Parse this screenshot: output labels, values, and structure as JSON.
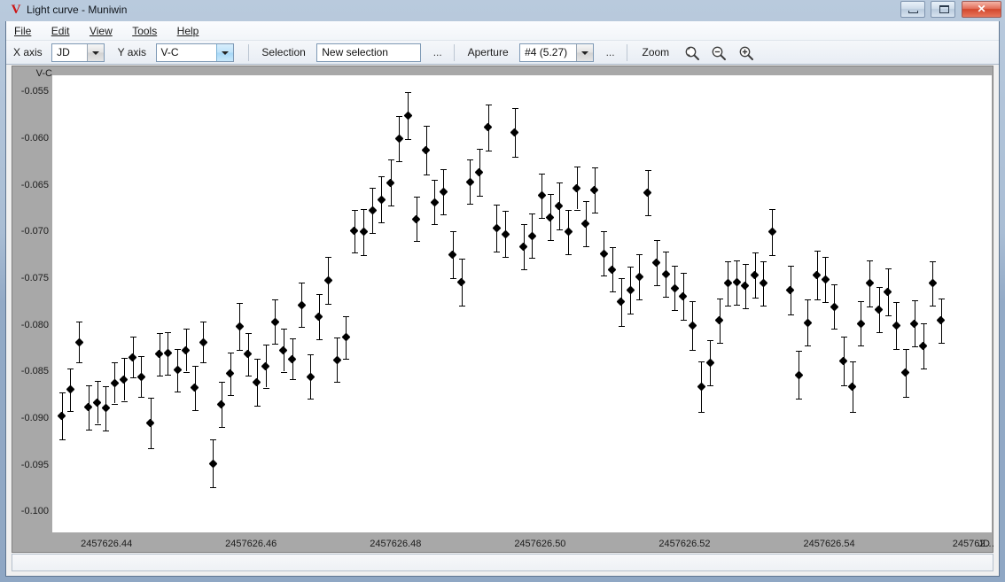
{
  "window": {
    "title": "Light curve - Muniwin",
    "app_icon": "muniwin-v-icon",
    "buttons": {
      "minimize": "minimize",
      "maximize": "maximize",
      "close": "✕"
    }
  },
  "menu": {
    "items": [
      "File",
      "Edit",
      "View",
      "Tools",
      "Help"
    ]
  },
  "toolbar": {
    "x_axis_label": "X axis",
    "x_axis_value": "JD",
    "y_axis_label": "Y axis",
    "y_axis_value": "V-C",
    "selection_label": "Selection",
    "selection_value": "New selection",
    "selection_more": "...",
    "aperture_label": "Aperture",
    "aperture_value": "#4 (5.27)",
    "aperture_more": "...",
    "zoom_label": "Zoom",
    "zoom_fit_icon": "zoom-fit-icon",
    "zoom_out_icon": "zoom-out-icon",
    "zoom_in_icon": "zoom-in-icon"
  },
  "chart_data": {
    "type": "scatter",
    "title": "",
    "xlabel": "JD",
    "ylabel": "V-C",
    "grid": false,
    "legend": null,
    "errorbars": true,
    "marker": "filled-diamond",
    "marker_color": "#000000",
    "xlim": [
      2457626.4325,
      2457626.5625
    ],
    "ylim": [
      -0.1022,
      -0.0532
    ],
    "y_inverted": false,
    "xticks": [
      2457626.44,
      2457626.46,
      2457626.48,
      2457626.5,
      2457626.52,
      2457626.54,
      2457626.56
    ],
    "xtick_labels": [
      "2457626.44",
      "2457626.46",
      "2457626.48",
      "2457626.50",
      "2457626.52",
      "2457626.54",
      "245762…"
    ],
    "yticks": [
      -0.1,
      -0.095,
      -0.09,
      -0.085,
      -0.08,
      -0.075,
      -0.07,
      -0.065,
      -0.06,
      -0.055
    ],
    "ytick_labels": [
      "-0.100",
      "-0.095",
      "-0.090",
      "-0.085",
      "-0.080",
      "-0.075",
      "-0.070",
      "-0.065",
      "-0.060",
      "-0.055"
    ],
    "series_name": "V-C",
    "x": [
      2457626.4338,
      2457626.435,
      2457626.4362,
      2457626.4375,
      2457626.4387,
      2457626.4399,
      2457626.4411,
      2457626.4424,
      2457626.4436,
      2457626.4448,
      2457626.4461,
      2457626.4473,
      2457626.4485,
      2457626.4498,
      2457626.451,
      2457626.4522,
      2457626.4534,
      2457626.4547,
      2457626.4559,
      2457626.4571,
      2457626.4584,
      2457626.4596,
      2457626.4608,
      2457626.462,
      2457626.4633,
      2457626.4645,
      2457626.4657,
      2457626.467,
      2457626.4682,
      2457626.4694,
      2457626.4707,
      2457626.4719,
      2457626.4731,
      2457626.4743,
      2457626.4756,
      2457626.4768,
      2457626.478,
      2457626.4793,
      2457626.4805,
      2457626.4817,
      2457626.4829,
      2457626.4842,
      2457626.4854,
      2457626.4866,
      2457626.4879,
      2457626.4891,
      2457626.4903,
      2457626.4916,
      2457626.4928,
      2457626.494,
      2457626.4952,
      2457626.4965,
      2457626.4977,
      2457626.4989,
      2457626.5002,
      2457626.5014,
      2457626.5026,
      2457626.5039,
      2457626.5051,
      2457626.5063,
      2457626.5075,
      2457626.5088,
      2457626.51,
      2457626.5112,
      2457626.5125,
      2457626.5137,
      2457626.5149,
      2457626.5161,
      2457626.5174,
      2457626.5186,
      2457626.5198,
      2457626.5211,
      2457626.5223,
      2457626.5235,
      2457626.5248,
      2457626.526,
      2457626.5272,
      2457626.5284,
      2457626.5297,
      2457626.5309,
      2457626.5321,
      2457626.5346,
      2457626.5358,
      2457626.537,
      2457626.5383,
      2457626.5395,
      2457626.5407,
      2457626.542,
      2457626.5432,
      2457626.5444,
      2457626.5456,
      2457626.5469,
      2457626.5481,
      2457626.5493,
      2457626.5506,
      2457626.5518,
      2457626.553,
      2457626.5543,
      2457626.5555
    ],
    "y": [
      -0.0897,
      -0.0869,
      -0.0818,
      -0.0888,
      -0.0883,
      -0.0889,
      -0.0862,
      -0.0858,
      -0.0834,
      -0.0855,
      -0.0905,
      -0.0831,
      -0.083,
      -0.0848,
      -0.0827,
      -0.0867,
      -0.0818,
      -0.0948,
      -0.0885,
      -0.0852,
      -0.0801,
      -0.0831,
      -0.0861,
      -0.0844,
      -0.0796,
      -0.0827,
      -0.0836,
      -0.0778,
      -0.0855,
      -0.0791,
      -0.0752,
      -0.0837,
      -0.0813,
      -0.0699,
      -0.07,
      -0.0677,
      -0.0665,
      -0.0647,
      -0.06,
      -0.0575,
      -0.0686,
      -0.0612,
      -0.0668,
      -0.0657,
      -0.0724,
      -0.0754,
      -0.0646,
      -0.0636,
      -0.0588,
      -0.0696,
      -0.0702,
      -0.0593,
      -0.0716,
      -0.0704,
      -0.0661,
      -0.0684,
      -0.0672,
      -0.07,
      -0.0653,
      -0.0691,
      -0.0655,
      -0.0723,
      -0.074,
      -0.0775,
      -0.0762,
      -0.0748,
      -0.0658,
      -0.0733,
      -0.0745,
      -0.076,
      -0.0769,
      -0.08,
      -0.0866,
      -0.084,
      -0.0795,
      -0.0755,
      -0.0754,
      -0.0758,
      -0.0746,
      -0.0755,
      -0.07,
      -0.0762,
      -0.0853,
      -0.0797,
      -0.0746,
      -0.0751,
      -0.078,
      -0.0838,
      -0.0866,
      -0.0798,
      -0.0755,
      -0.0783,
      -0.0764,
      -0.08,
      -0.0851,
      -0.0798,
      -0.0822,
      -0.0755,
      -0.0795
    ],
    "yerr": [
      0.0025,
      0.0023,
      0.0022,
      0.0024,
      0.0023,
      0.0024,
      0.0022,
      0.0023,
      0.0022,
      0.0022,
      0.0027,
      0.0023,
      0.0023,
      0.0023,
      0.0023,
      0.0024,
      0.0022,
      0.0026,
      0.0024,
      0.0023,
      0.0025,
      0.0023,
      0.0025,
      0.0023,
      0.0024,
      0.0023,
      0.0022,
      0.0024,
      0.0024,
      0.0024,
      0.0025,
      0.0024,
      0.0023,
      0.0023,
      0.0025,
      0.0024,
      0.0025,
      0.0025,
      0.0024,
      0.0025,
      0.0024,
      0.0026,
      0.0024,
      0.0024,
      0.0025,
      0.0025,
      0.0024,
      0.0025,
      0.0025,
      0.0025,
      0.0025,
      0.0026,
      0.0024,
      0.0024,
      0.0024,
      0.0025,
      0.0025,
      0.0024,
      0.0023,
      0.0024,
      0.0024,
      0.0024,
      0.0024,
      0.0026,
      0.0025,
      0.0024,
      0.0024,
      0.0024,
      0.0024,
      0.0024,
      0.0025,
      0.0026,
      0.0027,
      0.0024,
      0.0024,
      0.0024,
      0.0024,
      0.0024,
      0.0024,
      0.0024,
      0.0025,
      0.0026,
      0.0026,
      0.0025,
      0.0026,
      0.0024,
      0.0024,
      0.0026,
      0.0027,
      0.0024,
      0.0025,
      0.0024,
      0.0025,
      0.0025,
      0.0026,
      0.0025,
      0.0024,
      0.0024,
      0.0024
    ]
  }
}
